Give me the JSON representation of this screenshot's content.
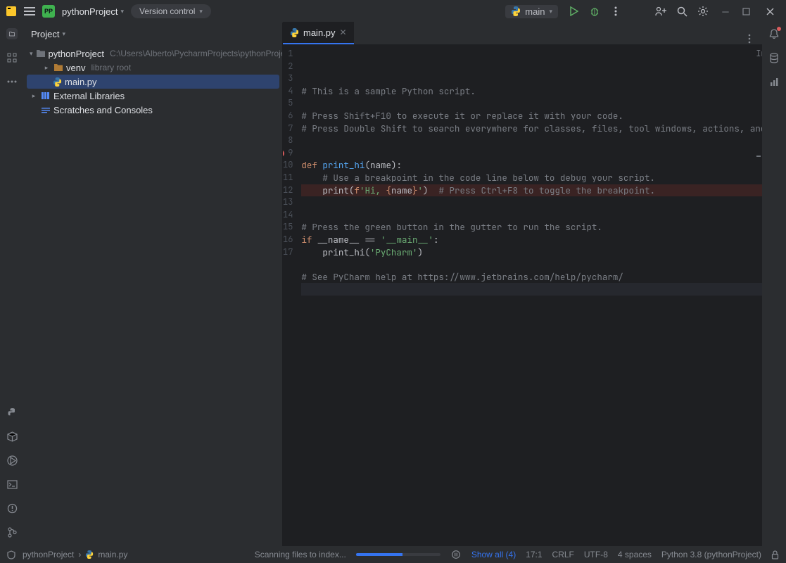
{
  "titlebar": {
    "pp_text": "PP",
    "project_name": "pythonProject",
    "vc_label": "Version control",
    "run_config_label": "main"
  },
  "project_panel": {
    "header": "Project",
    "tree": {
      "root_name": "pythonProject",
      "root_path": "C:\\Users\\Alberto\\PycharmProjects\\pythonProject",
      "venv_name": "venv",
      "venv_hint": "library root",
      "main_py": "main.py",
      "ext_lib": "External Libraries",
      "scratches": "Scratches and Consoles"
    }
  },
  "editor": {
    "tab_name": "main.py",
    "indexing_label": "Indexing...",
    "lines": [
      {
        "n": 1,
        "segs": [
          {
            "c": "c-comment",
            "t": "# This is a sample Python script."
          }
        ]
      },
      {
        "n": 2,
        "segs": []
      },
      {
        "n": 3,
        "segs": [
          {
            "c": "c-comment",
            "t": "# Press Shift+F10 to execute it or replace it with your code."
          }
        ]
      },
      {
        "n": 4,
        "segs": [
          {
            "c": "c-comment",
            "t": "# Press Double Shift to search everywhere for classes, files, tool windows, actions, and settings."
          }
        ]
      },
      {
        "n": 5,
        "segs": []
      },
      {
        "n": 6,
        "segs": []
      },
      {
        "n": 7,
        "segs": [
          {
            "c": "c-kw",
            "t": "def "
          },
          {
            "c": "c-fn",
            "t": "print_hi"
          },
          {
            "c": "",
            "t": "(name):"
          }
        ]
      },
      {
        "n": 8,
        "segs": [
          {
            "c": "",
            "t": "    "
          },
          {
            "c": "c-comment",
            "t": "# Use a breakpoint in the code line below to debug your script."
          }
        ]
      },
      {
        "n": 9,
        "bp": true,
        "segs": [
          {
            "c": "",
            "t": "    print("
          },
          {
            "c": "c-kw",
            "t": "f"
          },
          {
            "c": "c-str",
            "t": "'Hi, "
          },
          {
            "c": "c-kw",
            "t": "{"
          },
          {
            "c": "",
            "t": "name"
          },
          {
            "c": "c-kw",
            "t": "}"
          },
          {
            "c": "c-str",
            "t": "'"
          },
          {
            "c": "",
            "t": ")  "
          },
          {
            "c": "c-comment",
            "t": "# Press Ctrl+F8 to toggle the breakpoint."
          }
        ]
      },
      {
        "n": 10,
        "segs": []
      },
      {
        "n": 11,
        "segs": []
      },
      {
        "n": 12,
        "segs": [
          {
            "c": "c-comment",
            "t": "# Press the green button in the gutter to run the script."
          }
        ]
      },
      {
        "n": 13,
        "segs": [
          {
            "c": "c-kw",
            "t": "if "
          },
          {
            "c": "",
            "t": "__name__ == "
          },
          {
            "c": "c-str",
            "t": "'__main__'"
          },
          {
            "c": "",
            "t": ":"
          }
        ]
      },
      {
        "n": 14,
        "segs": [
          {
            "c": "",
            "t": "    print_hi("
          },
          {
            "c": "c-str",
            "t": "'PyCharm'"
          },
          {
            "c": "",
            "t": ")"
          }
        ]
      },
      {
        "n": 15,
        "segs": []
      },
      {
        "n": 16,
        "segs": [
          {
            "c": "c-comment",
            "t": "# See PyCharm help at https://www.jetbrains.com/help/pycharm/"
          }
        ]
      },
      {
        "n": 17,
        "current": true,
        "segs": []
      }
    ]
  },
  "statusbar": {
    "crumb_project": "pythonProject",
    "crumb_file": "main.py",
    "scanning": "Scanning files to index...",
    "progress_pct": 55,
    "show_all": "Show all (4)",
    "caret": "17:1",
    "line_sep": "CRLF",
    "encoding": "UTF-8",
    "indent": "4 spaces",
    "interpreter": "Python 3.8 (pythonProject)"
  }
}
